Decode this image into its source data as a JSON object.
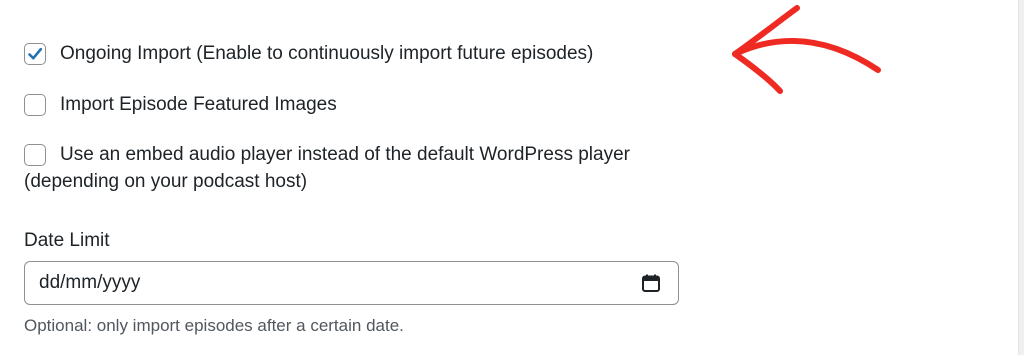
{
  "options": [
    {
      "label": "Ongoing Import (Enable to continuously import future episodes)",
      "checked": true
    },
    {
      "label": "Import Episode Featured Images",
      "checked": false
    },
    {
      "label": "Use an embed audio player instead of the default WordPress player",
      "label_cont": "(depending on your podcast host)",
      "checked": false
    }
  ],
  "date_limit": {
    "label": "Date Limit",
    "placeholder": "dd/mm/yyyy",
    "help": "Optional: only import episodes after a certain date."
  },
  "icons": {
    "checkmark": "checkmark-icon",
    "calendar": "calendar-icon",
    "annotation": "red-arrow-annotation"
  },
  "colors": {
    "checkmark": "#2271b1",
    "arrow": "#ee2a22",
    "border": "#8c8f94",
    "help_text": "#50575e"
  }
}
